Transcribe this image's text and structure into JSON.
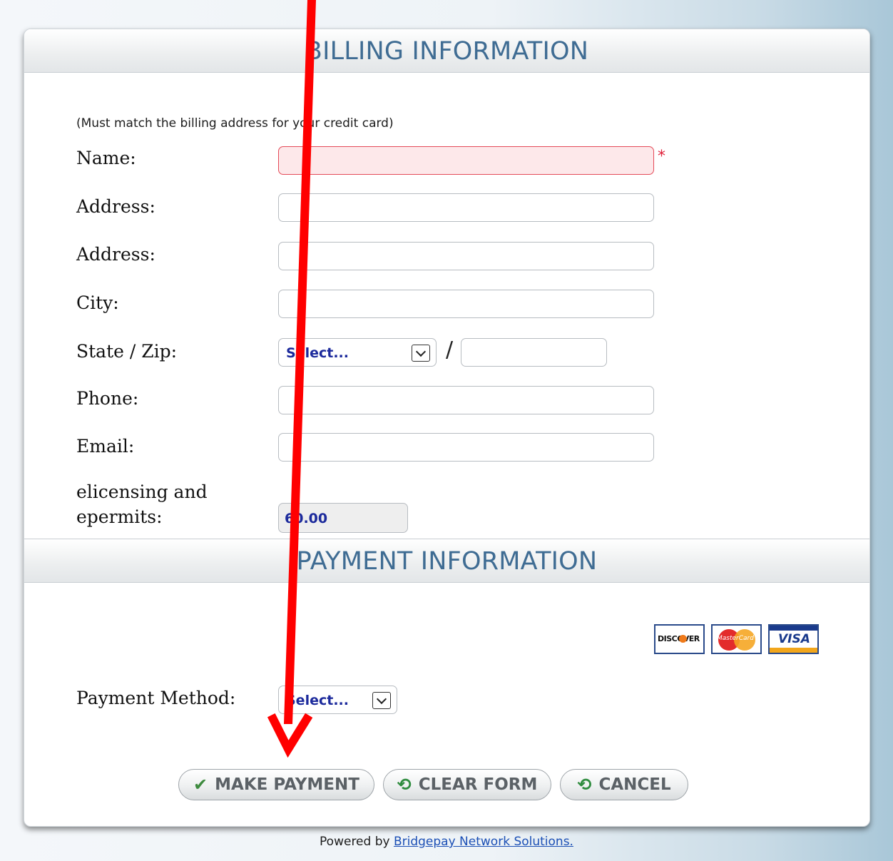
{
  "billing": {
    "header": "BILLING INFORMATION",
    "note": "(Must match the billing address for your credit card)",
    "name_label": "Name:",
    "name_required_mark": "*",
    "address1_label": "Address:",
    "address2_label": "Address:",
    "city_label": "City:",
    "state_zip_label": "State / Zip:",
    "state_select_value": "Select...",
    "zip_separator": "/",
    "phone_label": "Phone:",
    "email_label": "Email:",
    "fee_label_line1": "elicensing and",
    "fee_label_line2": "epermits:",
    "fee_amount": "60.00",
    "name_value": "",
    "address1_value": "",
    "address2_value": "",
    "city_value": "",
    "zip_value": "",
    "phone_value": "",
    "email_value": ""
  },
  "payment": {
    "header": "PAYMENT INFORMATION",
    "cards": {
      "discover": "DISCOVER",
      "mastercard": "MasterCard",
      "visa": "VISA"
    },
    "method_label": "Payment Method:",
    "method_select_value": "Select..."
  },
  "buttons": {
    "make_payment": "MAKE PAYMENT",
    "clear_form": "CLEAR FORM",
    "cancel": "CANCEL"
  },
  "footer": {
    "prefix": "Powered by",
    "link_text": "Bridgepay Network Solutions."
  },
  "colors": {
    "header_text": "#3f6c93",
    "required": "#e0223b",
    "select_text": "#1c2a9c",
    "annotation_arrow": "#ff0000"
  },
  "icons": {
    "make_payment": "checkmark-icon",
    "clear_form": "undo-icon",
    "cancel": "undo-icon"
  }
}
